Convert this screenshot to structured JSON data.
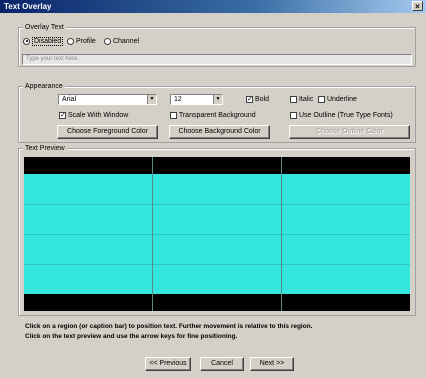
{
  "window": {
    "title": "Text Overlay",
    "close": "×"
  },
  "overlay_text": {
    "group_label": "Overlay Text",
    "options": [
      {
        "label": "Disabled",
        "selected": true
      },
      {
        "label": "Profile",
        "selected": false
      },
      {
        "label": "Channel",
        "selected": false
      }
    ],
    "input_placeholder": "Type your text here."
  },
  "appearance": {
    "group_label": "Appearance",
    "font": "Arial",
    "size": "12",
    "bold": {
      "label": "Bold",
      "checked": true
    },
    "italic": {
      "label": "Italic",
      "checked": false
    },
    "underline": {
      "label": "Underline",
      "checked": false
    },
    "scale_with_window": {
      "label": "Scale With Window",
      "checked": true
    },
    "transparent_background": {
      "label": "Transparent Background",
      "checked": false
    },
    "use_outline": {
      "label": "Use Outline (True Type Fonts)",
      "checked": false
    },
    "foreground_button": "Choose Foreground Color",
    "background_button": "Choose Background Color",
    "outline_button": "Choose Outline Color"
  },
  "text_preview": {
    "group_label": "Text Preview",
    "band_color": "#33e6de",
    "caption_color": "#000000"
  },
  "instructions": {
    "line1": "Click on a region (or caption bar) to position text.  Further movement is relative to this region.",
    "line2": "Click on the text preview and use the arrow keys for fine positioning."
  },
  "nav": {
    "previous": "<< Previous",
    "cancel": "Cancel",
    "next": "Next >>"
  }
}
